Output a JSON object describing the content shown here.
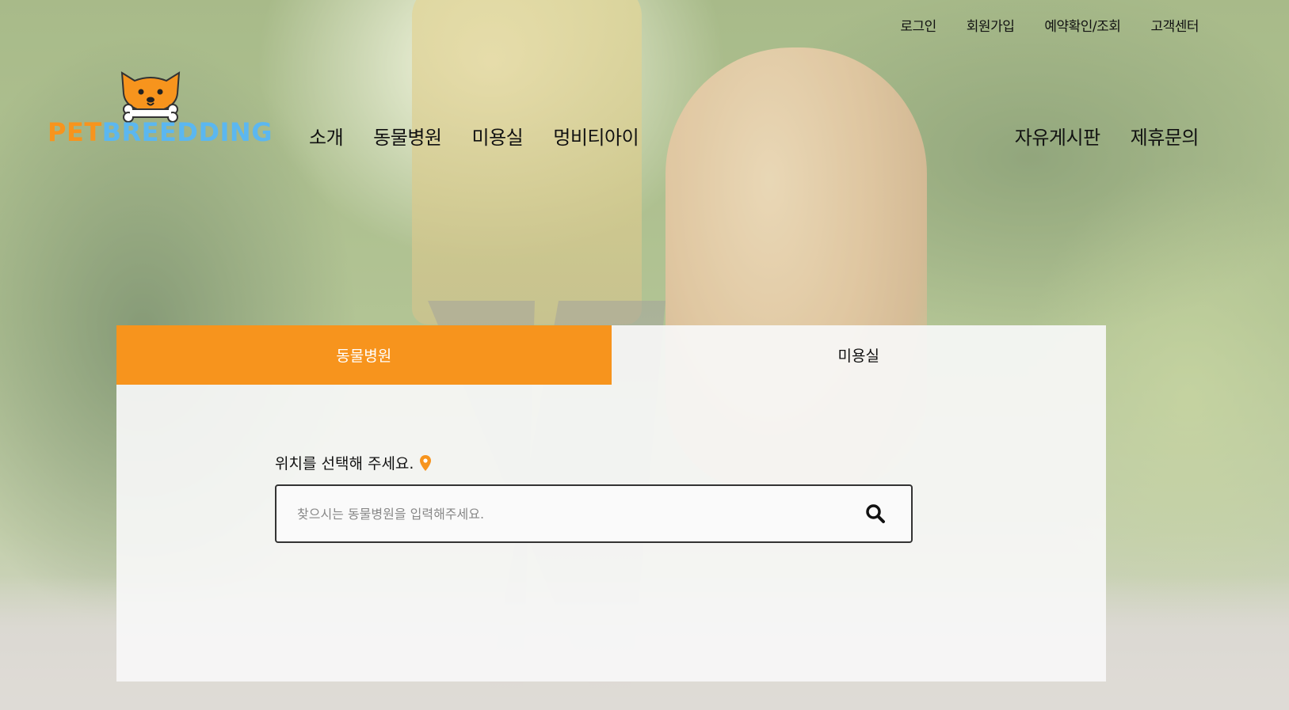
{
  "brand": {
    "logo_part1": "PET",
    "logo_part2": "BREEDDING",
    "accent_color": "#f7941d",
    "secondary_color": "#5bb7f0"
  },
  "util_nav": [
    {
      "label": "로그인"
    },
    {
      "label": "회원가입"
    },
    {
      "label": "예약확인/조회"
    },
    {
      "label": "고객센터"
    }
  ],
  "main_nav_left": [
    {
      "label": "소개"
    },
    {
      "label": "동물병원"
    },
    {
      "label": "미용실"
    },
    {
      "label": "멍비티아이"
    }
  ],
  "main_nav_right": [
    {
      "label": "자유게시판"
    },
    {
      "label": "제휴문의"
    }
  ],
  "search_panel": {
    "tabs": [
      {
        "label": "동물병원",
        "active": true
      },
      {
        "label": "미용실",
        "active": false
      }
    ],
    "location_label": "위치를 선택해 주세요.",
    "location_icon": "map-pin-icon",
    "search_placeholder": "찾으시는 동물병원을 입력해주세요.",
    "search_value": "",
    "search_icon": "search-icon"
  }
}
